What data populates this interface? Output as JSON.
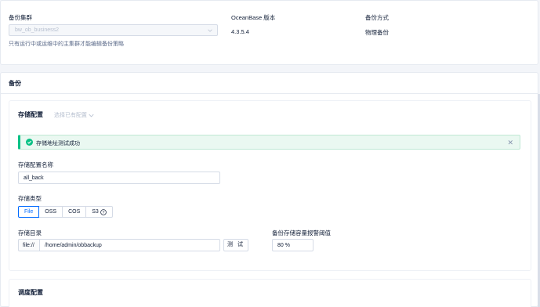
{
  "summary": {
    "cluster_label": "备份集群",
    "cluster_value": "bw_ob_business2",
    "cluster_hint": "只有运行中或运维中的主集群才能编辑备份策略",
    "version_label": "OceanBase 版本",
    "version_value": "4.3.5.4",
    "mode_label": "备份方式",
    "mode_value": "物理备份"
  },
  "section_title": "备份",
  "storage": {
    "title": "存储配置",
    "select_existing": "选择已有配置",
    "alert_message": "存储地址测试成功",
    "name_label": "存储配置名称",
    "name_value": "all_back",
    "type_label": "存储类型",
    "types": [
      "File",
      "OSS",
      "COS",
      "S3"
    ],
    "selected_type": "File",
    "dir_label": "存储目录",
    "dir_prefix": "file://",
    "dir_value": "/home/admin/obbackup",
    "test_button": "测 试",
    "threshold_label": "备份存储容量报警阈值",
    "threshold_value": "80 %"
  },
  "schedule": {
    "title": "调度配置"
  },
  "colors": {
    "primary": "#006aff",
    "success": "#0ac185",
    "text": "#132039",
    "border": "#d5dbe6"
  }
}
